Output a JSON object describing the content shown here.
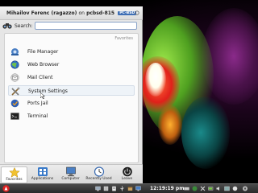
{
  "user": {
    "name": "Mihailov Ferenc (ragazzo)",
    "host_prefix": "on",
    "host": "pcbsd-815",
    "tag": "PC-BSD"
  },
  "search": {
    "label": "Search:",
    "value": ""
  },
  "favorites": {
    "section_label": "Favorites",
    "items": [
      {
        "label": "File Manager",
        "icon": "file-manager-icon"
      },
      {
        "label": "Web Browser",
        "icon": "globe-icon"
      },
      {
        "label": "Mail Client",
        "icon": "mail-icon"
      },
      {
        "label": "System Settings",
        "icon": "settings-tools-icon"
      },
      {
        "label": "Ports Jail",
        "icon": "ports-jail-icon"
      },
      {
        "label": "Terminal",
        "icon": "terminal-icon"
      }
    ]
  },
  "tabs": [
    {
      "label": "Favorites",
      "icon": "star-icon",
      "active": true
    },
    {
      "label": "Applications",
      "icon": "applications-icon",
      "active": false
    },
    {
      "label": "Computer",
      "icon": "computer-icon",
      "active": false
    },
    {
      "label": "Recently Used",
      "icon": "recent-icon",
      "active": false
    },
    {
      "label": "Leave",
      "icon": "power-icon",
      "active": false
    }
  ],
  "taskbar": {
    "clock": "12:19:19 pm"
  },
  "colors": {
    "accent": "#3f6fb5",
    "panel_bg": "#e6e6e6",
    "taskbar_bg": "#333333"
  }
}
